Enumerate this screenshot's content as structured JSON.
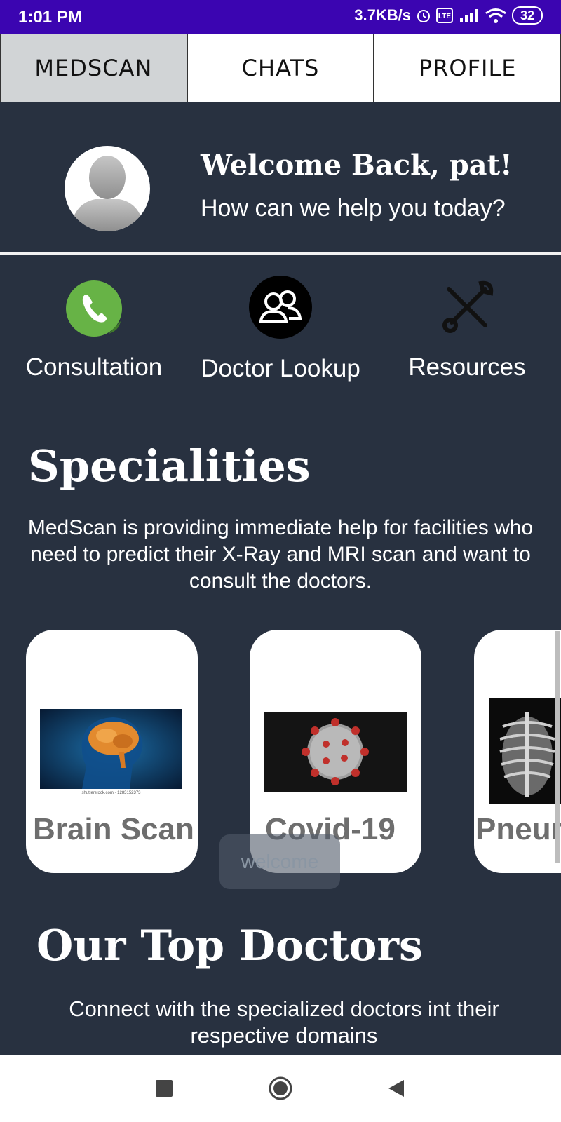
{
  "status_bar": {
    "time": "1:01 PM",
    "net_speed": "3.7KB/s",
    "battery": "32"
  },
  "tabs": [
    {
      "label": "MEDSCAN",
      "active": true
    },
    {
      "label": "CHATS",
      "active": false
    },
    {
      "label": "PROFILE",
      "active": false
    }
  ],
  "header": {
    "title": "Welcome Back, pat!",
    "subtitle": "How can we help you today?"
  },
  "actions": [
    {
      "label": "Consultation",
      "icon": "phone-icon",
      "color": "#67b346"
    },
    {
      "label": "Doctor Lookup",
      "icon": "doctors-group-icon",
      "color": "#000000"
    },
    {
      "label": "Resources",
      "icon": "tools-icon",
      "color": "#111111"
    }
  ],
  "specialities": {
    "title": "Specialities",
    "description": "MedScan is providing immediate help for facilities who need to predict their X-Ray and MRI scan and want to consult the doctors.",
    "cards": [
      {
        "label": "Brain Scan",
        "image": "brain-scan-image",
        "caption": "shutterstock.com · 1283152373"
      },
      {
        "label": "Covid-19",
        "image": "covid-virus-image"
      },
      {
        "label": "Pneur",
        "image": "chest-xray-image"
      }
    ]
  },
  "toast": "welcome",
  "doctors": {
    "title": "Our Top Doctors",
    "description": "Connect with the specialized doctors int their respective domains"
  },
  "colors": {
    "status_bar": "#3b05b1",
    "background": "#283140",
    "tab_active": "#d1d4d6"
  }
}
